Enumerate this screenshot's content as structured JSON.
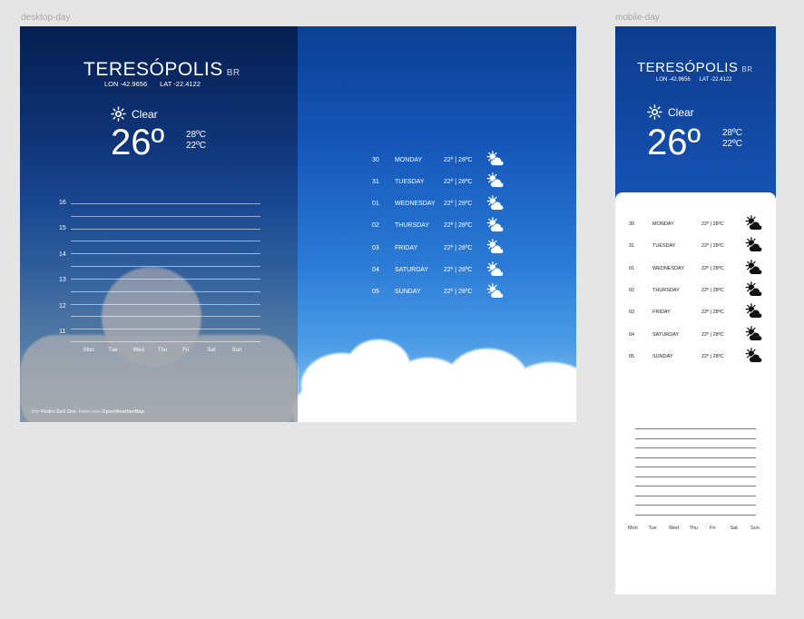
{
  "frames": {
    "desktop_label": "desktop-day",
    "mobile_label": "mobile-day"
  },
  "location": {
    "city": "TERESÓPOLIS",
    "country": "BR",
    "lon": "LON -42.9656",
    "lat": "LAT -22.4122"
  },
  "current": {
    "condition": "Clear",
    "temp": "26º",
    "max": "28ºC",
    "min": "22ºC",
    "icon": "sun-icon"
  },
  "chart_data": {
    "type": "line",
    "title": "",
    "xlabel": "",
    "ylabel": "",
    "categories": [
      "Mon",
      "Tue",
      "Wed",
      "Thu",
      "Fri",
      "Sat",
      "Sun"
    ],
    "ytick_labels": [
      "16",
      "15",
      "14",
      "13",
      "12",
      "11"
    ],
    "ylim": [
      10.5,
      16
    ],
    "series": [],
    "grid": true
  },
  "forecast": [
    {
      "day": "30",
      "name": "MONDAY",
      "temps": "22º | 28ºC",
      "icon": "partly-cloudy-icon"
    },
    {
      "day": "31",
      "name": "TUESDAY",
      "temps": "22º | 28ºC",
      "icon": "partly-cloudy-icon"
    },
    {
      "day": "01",
      "name": "WEDNESDAY",
      "temps": "22º | 28ºC",
      "icon": "partly-cloudy-icon"
    },
    {
      "day": "02",
      "name": "THURSDAY",
      "temps": "22º | 28ºC",
      "icon": "partly-cloudy-icon"
    },
    {
      "day": "03",
      "name": "FRIDAY",
      "temps": "22º | 28ºC",
      "icon": "partly-cloudy-icon"
    },
    {
      "day": "04",
      "name": "SATURDAY",
      "temps": "22º | 28ºC",
      "icon": "partly-cloudy-icon"
    },
    {
      "day": "05",
      "name": "SUNDAY",
      "temps": "22º | 28ºC",
      "icon": "partly-cloudy-icon"
    }
  ],
  "credit": {
    "prefix": "Por ",
    "author": "Pedro Dell Oro",
    "middle": ". Feito com ",
    "service": "OpenWeatherMap",
    "suffix": "."
  },
  "colors": {
    "sky_top": "#0b3f93",
    "sky_mid": "#2a7bd6",
    "panel_dark": "#051946",
    "mobile_header": "#1652b3"
  }
}
